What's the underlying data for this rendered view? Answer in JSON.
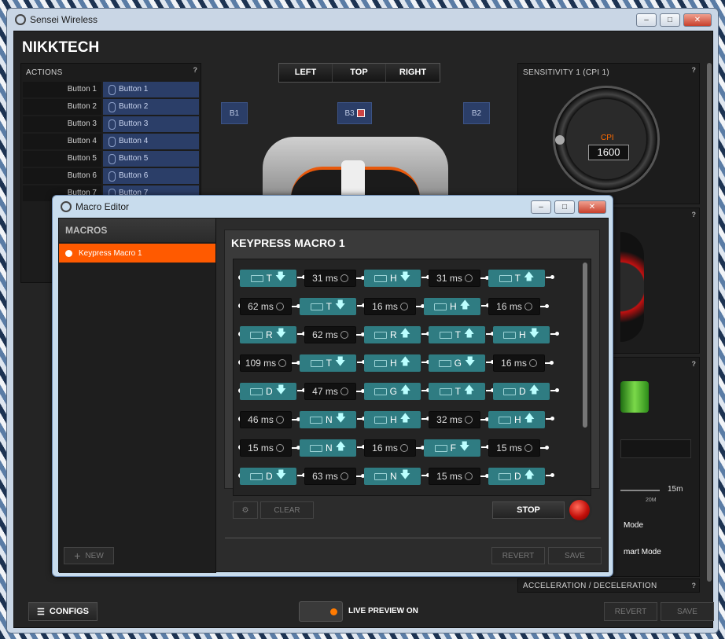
{
  "app_title": "Sensei Wireless",
  "brand": "NIKKTECH",
  "actions": {
    "header": "ACTIONS",
    "rows": [
      {
        "name": "Button 1",
        "value": "Button 1"
      },
      {
        "name": "Button 2",
        "value": "Button 2"
      },
      {
        "name": "Button 3",
        "value": "Button 3"
      },
      {
        "name": "Button 4",
        "value": "Button 4"
      },
      {
        "name": "Button 5",
        "value": "Button 5"
      },
      {
        "name": "Button 6",
        "value": "Button 6"
      },
      {
        "name": "Button 7",
        "value": "Button 7"
      }
    ]
  },
  "view_tabs": [
    "LEFT",
    "TOP",
    "RIGHT"
  ],
  "mouse_buttons": {
    "b1": "B1",
    "b2": "B2",
    "b3": "B3"
  },
  "sensitivity": {
    "header": "SENSITIVITY 1 (CPI 1)",
    "cpi_label": "CPI",
    "cpi_value": "1600"
  },
  "help": "?",
  "configs_label": "CONFIGS",
  "live_preview": "LIVE PREVIEW ON",
  "revert": "REVERT",
  "save": "SAVE",
  "accel_label": "ACCELERATION / DECELERATION",
  "partial": {
    "mode": "Mode",
    "smart_mode": "mart Mode",
    "sleep_value": "15m",
    "sleep_tick": "20M"
  },
  "macro": {
    "window_title": "Macro Editor",
    "list_header": "MACROS",
    "selected": "Keypress Macro 1",
    "title": "KEYPRESS MACRO 1",
    "new_label": "NEW",
    "clear_label": "CLEAR",
    "stop_label": "STOP",
    "revert": "REVERT",
    "save": "SAVE",
    "rows": [
      [
        {
          "k": "T",
          "d": "down"
        },
        {
          "t": "31 ms"
        },
        {
          "k": "H",
          "d": "down"
        },
        {
          "t": "31 ms"
        },
        {
          "k": "T",
          "d": "up"
        }
      ],
      [
        {
          "t": "62 ms"
        },
        {
          "k": "T",
          "d": "down"
        },
        {
          "t": "16 ms"
        },
        {
          "k": "H",
          "d": "up"
        },
        {
          "t": "16 ms"
        }
      ],
      [
        {
          "k": "R",
          "d": "down"
        },
        {
          "t": "62 ms"
        },
        {
          "k": "R",
          "d": "up"
        },
        {
          "k": "T",
          "d": "up"
        },
        {
          "k": "H",
          "d": "down"
        }
      ],
      [
        {
          "t": "109 ms"
        },
        {
          "k": "T",
          "d": "down"
        },
        {
          "k": "H",
          "d": "up"
        },
        {
          "k": "G",
          "d": "down"
        },
        {
          "t": "16 ms"
        }
      ],
      [
        {
          "k": "D",
          "d": "down"
        },
        {
          "t": "47 ms"
        },
        {
          "k": "G",
          "d": "up"
        },
        {
          "k": "T",
          "d": "up"
        },
        {
          "k": "D",
          "d": "up"
        }
      ],
      [
        {
          "t": "46 ms"
        },
        {
          "k": "N",
          "d": "down"
        },
        {
          "k": "H",
          "d": "up"
        },
        {
          "t": "32 ms"
        },
        {
          "k": "H",
          "d": "up"
        }
      ],
      [
        {
          "t": "15 ms"
        },
        {
          "k": "N",
          "d": "up"
        },
        {
          "t": "16 ms"
        },
        {
          "k": "F",
          "d": "down"
        },
        {
          "t": "15 ms"
        }
      ],
      [
        {
          "k": "D",
          "d": "down"
        },
        {
          "t": "63 ms"
        },
        {
          "k": "N",
          "d": "down"
        },
        {
          "t": "15 ms"
        },
        {
          "k": "D",
          "d": "up"
        }
      ]
    ]
  }
}
